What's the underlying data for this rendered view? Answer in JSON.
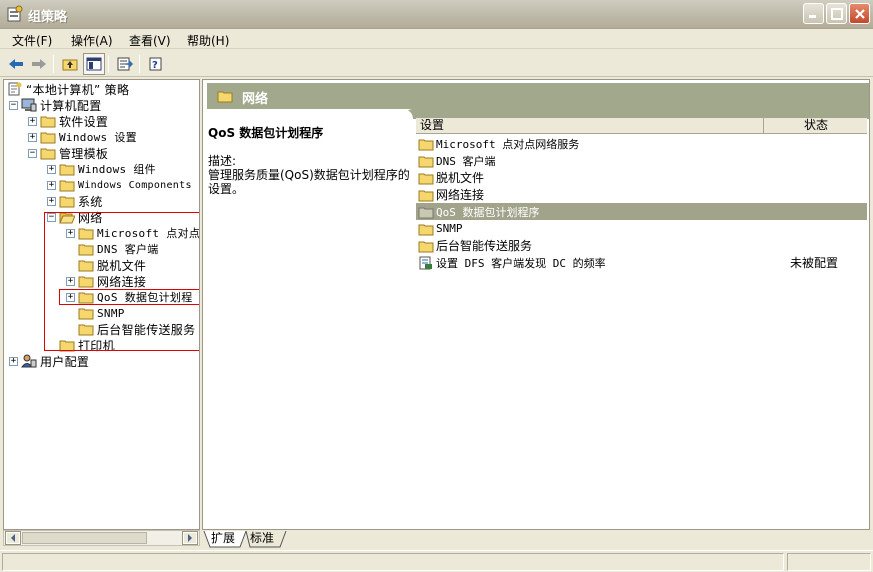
{
  "window": {
    "title": "组策略"
  },
  "menu": [
    {
      "label": "文件(F)"
    },
    {
      "label": "操作(A)"
    },
    {
      "label": "查看(V)"
    },
    {
      "label": "帮助(H)"
    }
  ],
  "tree": {
    "root": "“本地计算机” 策略",
    "computer_config": "计算机配置",
    "software_settings": "软件设置",
    "windows_settings": "Windows 设置",
    "admin_templates": "管理模板",
    "windows_components_cn": "Windows 组件",
    "windows_components_en": "Windows Components",
    "system": "系统",
    "network": "网络",
    "microsoft_p2p": "Microsoft 点对点",
    "dns_client": "DNS 客户端",
    "offline_files": "脱机文件",
    "network_connections": "网络连接",
    "qos": "QoS 数据包计划程",
    "snmp": "SNMP",
    "bits": "后台智能传送服务",
    "printers": "打印机",
    "user_config": "用户配置"
  },
  "right": {
    "header_title": "网络",
    "desc_title": "QoS 数据包计划程序",
    "desc_label": "描述:",
    "desc_text": "管理服务质量(QoS)数据包计划程序的设置。",
    "col_setting": "设置",
    "col_state": "状态",
    "rows": [
      {
        "name": "Microsoft 点对点网络服务",
        "state": ""
      },
      {
        "name": "DNS 客户端",
        "state": ""
      },
      {
        "name": "脱机文件",
        "state": ""
      },
      {
        "name": "网络连接",
        "state": ""
      },
      {
        "name": "QoS 数据包计划程序",
        "state": ""
      },
      {
        "name": "SNMP",
        "state": ""
      },
      {
        "name": "后台智能传送服务",
        "state": ""
      },
      {
        "name": "设置 DFS 客户端发现 DC 的频率",
        "state": "未被配置"
      }
    ]
  },
  "tabs": [
    {
      "label": "扩展"
    },
    {
      "label": "标准"
    }
  ],
  "colors": {
    "header": "#a2a88c",
    "selection": "#a2a38b",
    "annotation": "#e00000",
    "folder": "#f5d76e"
  },
  "icons": [
    "app-icon",
    "back-icon",
    "forward-icon",
    "up-folder-icon",
    "show-tree-icon",
    "export-list-icon",
    "help-icon",
    "folder-icon",
    "policy-icon",
    "computer-icon",
    "user-icon"
  ]
}
